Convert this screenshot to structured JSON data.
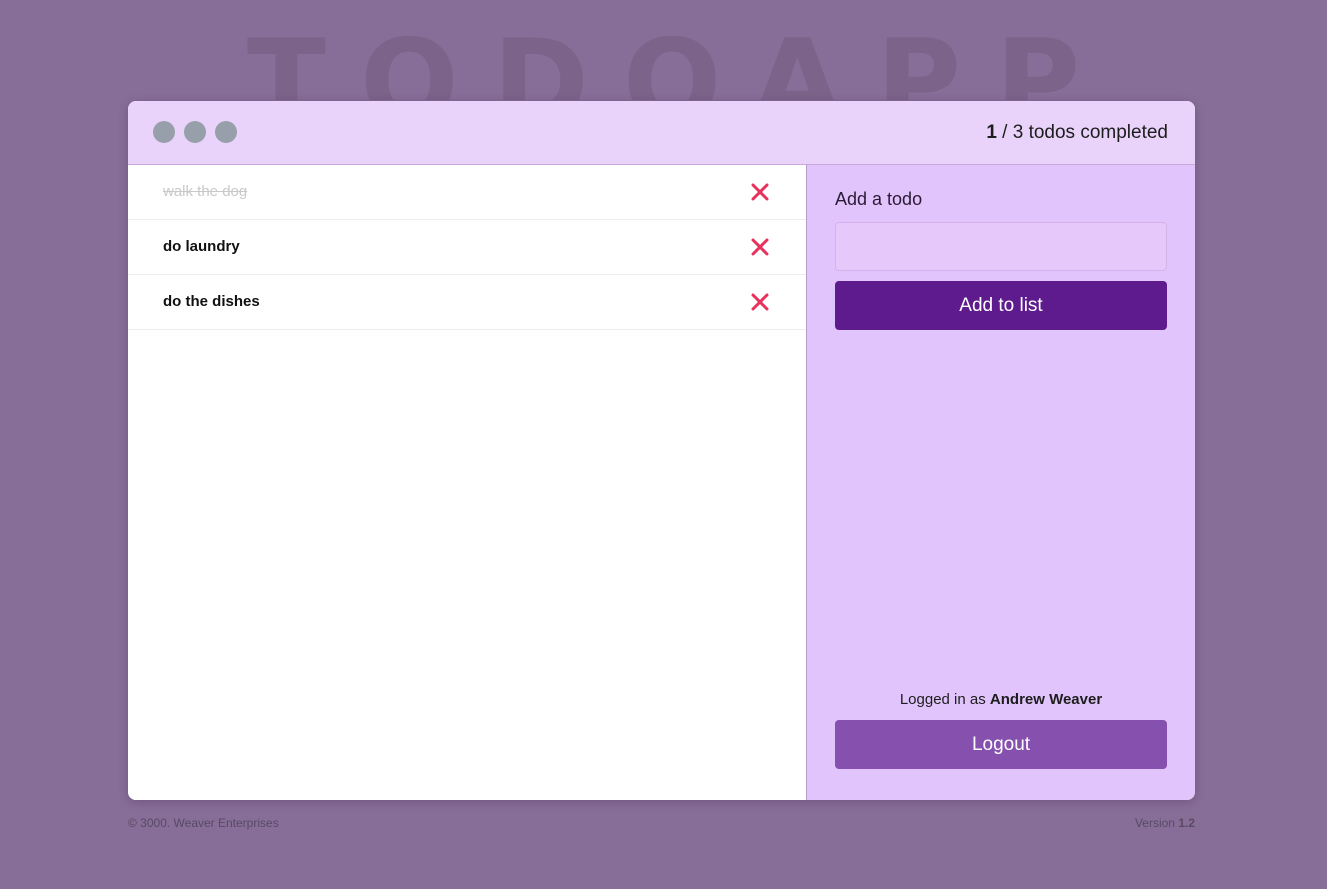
{
  "app": {
    "background_title": "TODOAPP"
  },
  "header": {
    "completed_count": "1",
    "counter_suffix": " / 3 todos completed"
  },
  "todos": [
    {
      "text": "walk the dog",
      "completed": true
    },
    {
      "text": "do laundry",
      "completed": false
    },
    {
      "text": "do the dishes",
      "completed": false
    }
  ],
  "sidebar": {
    "heading": "Add a todo",
    "input_value": "",
    "add_button": "Add to list",
    "logged_prefix": "Logged in as ",
    "user_name": "Andrew Weaver",
    "logout_button": "Logout"
  },
  "footer": {
    "copyright": "© 3000. Weaver Enterprises",
    "version_prefix": "Version ",
    "version": "1.2"
  },
  "icons": {
    "window_dots": [
      "window-dot-icon",
      "window-dot-icon",
      "window-dot-icon"
    ],
    "delete": "close-icon"
  },
  "colors": {
    "page_bg": "#876e98",
    "titlebar_bg": "#e9d3fa",
    "sidebar_bg": "#e1c4fb",
    "add_button_bg": "#5d1b8d",
    "logout_button_bg": "#8650af",
    "delete_icon": "#e8315c",
    "window_dot": "#97a0aa"
  }
}
